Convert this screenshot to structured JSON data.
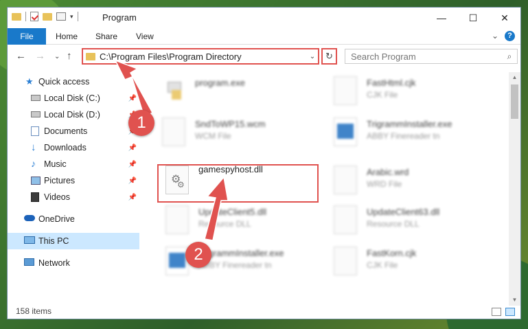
{
  "window": {
    "title": "Program",
    "controls": {
      "minimize": "—",
      "maximize": "☐",
      "close": "✕"
    }
  },
  "ribbon": {
    "file": "File",
    "tabs": [
      "Home",
      "Share",
      "View"
    ],
    "help": "?"
  },
  "address": {
    "path": "C:\\Program Files\\Program Directory"
  },
  "search": {
    "placeholder": "Search Program"
  },
  "sidebar": {
    "items": [
      {
        "label": "Quick access",
        "icon": "star-icon",
        "pinned": false
      },
      {
        "label": "Local Disk (C:)",
        "icon": "drive-icon",
        "pinned": true
      },
      {
        "label": "Local Disk (D:)",
        "icon": "drive-icon",
        "pinned": true
      },
      {
        "label": "Documents",
        "icon": "documents-icon",
        "pinned": true
      },
      {
        "label": "Downloads",
        "icon": "download-icon",
        "pinned": true
      },
      {
        "label": "Music",
        "icon": "music-icon",
        "pinned": true
      },
      {
        "label": "Pictures",
        "icon": "pictures-icon",
        "pinned": true
      },
      {
        "label": "Videos",
        "icon": "videos-icon",
        "pinned": true
      },
      {
        "label": "OneDrive",
        "icon": "cloud-icon",
        "pinned": false
      },
      {
        "label": "This PC",
        "icon": "computer-icon",
        "pinned": false
      },
      {
        "label": "Network",
        "icon": "network-icon",
        "pinned": false
      }
    ]
  },
  "files": [
    {
      "name": "program.exe",
      "type": ""
    },
    {
      "name": "FastHtml.cjk",
      "type": "CJK File"
    },
    {
      "name": "SndToWP15.wcm",
      "type": "WCM File"
    },
    {
      "name": "TrigrammInstaller.exe",
      "type": "ABBY Finereader tn"
    },
    {
      "name": "gamespyhost.dll",
      "type": ""
    },
    {
      "name": "Arabic.wrd",
      "type": "WRD File"
    },
    {
      "name": "UpdateClient5.dll",
      "type": "Resource DLL"
    },
    {
      "name": "UpdateClient63.dll",
      "type": "Resource DLL"
    },
    {
      "name": "TrigrammInstaller.exe",
      "type": "ABBY Finereader tn"
    },
    {
      "name": "FastKorn.cjk",
      "type": "CJK File"
    }
  ],
  "status": {
    "items": "158 items"
  },
  "annotations": {
    "step1": "1",
    "step2": "2",
    "color": "#e0524f"
  },
  "colors": {
    "accent": "#1979ca",
    "selected": "#cce8ff",
    "highlight": "#e0524f"
  }
}
